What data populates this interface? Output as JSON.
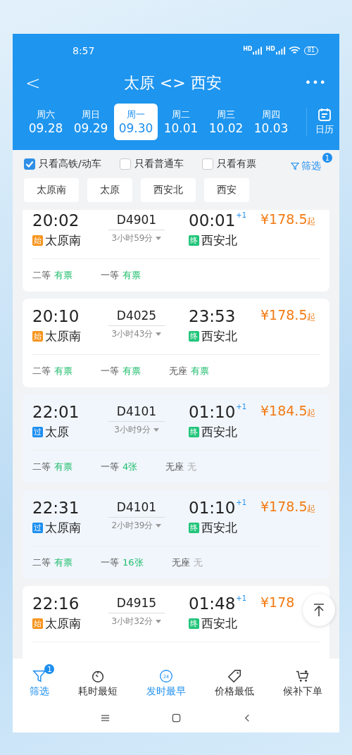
{
  "status_bar": {
    "time": "8:57",
    "signal_labels": [
      "HD",
      "HD"
    ],
    "battery": "81"
  },
  "header": {
    "back": "<",
    "title": "太原 <> 西安",
    "more": "•••"
  },
  "dates": [
    {
      "weekday": "周六",
      "date": "09.28",
      "selected": false
    },
    {
      "weekday": "周日",
      "date": "09.29",
      "selected": false
    },
    {
      "weekday": "周一",
      "date": "09.30",
      "selected": true
    },
    {
      "weekday": "周二",
      "date": "10.01",
      "selected": false
    },
    {
      "weekday": "周三",
      "date": "10.02",
      "selected": false
    },
    {
      "weekday": "周四",
      "date": "10.03",
      "selected": false
    }
  ],
  "calendar": {
    "label": "日历"
  },
  "filters": [
    {
      "label": "只看高铁/动车",
      "checked": true
    },
    {
      "label": "只看普通车",
      "checked": false
    },
    {
      "label": "只看有票",
      "checked": false
    }
  ],
  "filter_button": {
    "label": "筛选",
    "badge": "1"
  },
  "stations": [
    "太原南",
    "太原",
    "西安北",
    "西安"
  ],
  "trains": [
    {
      "depart": "20:02",
      "from": {
        "name": "太原南",
        "badge": "始",
        "kind": "start"
      },
      "number": "D4901",
      "duration": "3小时59分",
      "arrive": "00:01",
      "next_day": "+1",
      "to": {
        "name": "西安北",
        "badge": "终",
        "kind": "end"
      },
      "price": "¥178.5",
      "price_suffix": "起",
      "highlighted": false,
      "seats": [
        {
          "class": "二等",
          "status": "有票",
          "available": true
        },
        {
          "class": "一等",
          "status": "有票",
          "available": true
        }
      ]
    },
    {
      "depart": "20:10",
      "from": {
        "name": "太原南",
        "badge": "始",
        "kind": "start"
      },
      "number": "D4025",
      "duration": "3小时43分",
      "arrive": "23:53",
      "to": {
        "name": "西安北",
        "badge": "终",
        "kind": "end"
      },
      "price": "¥178.5",
      "price_suffix": "起",
      "highlighted": false,
      "seats": [
        {
          "class": "二等",
          "status": "有票",
          "available": true
        },
        {
          "class": "一等",
          "status": "有票",
          "available": true
        },
        {
          "class": "无座",
          "status": "有票",
          "available": true
        }
      ]
    },
    {
      "depart": "22:01",
      "from": {
        "name": "太原",
        "badge": "过",
        "kind": "pass"
      },
      "number": "D4101",
      "duration": "3小时9分",
      "arrive": "01:10",
      "next_day": "+1",
      "to": {
        "name": "西安北",
        "badge": "终",
        "kind": "end"
      },
      "price": "¥184.5",
      "price_suffix": "起",
      "highlighted": true,
      "seats": [
        {
          "class": "二等",
          "status": "有票",
          "available": true
        },
        {
          "class": "一等",
          "status": "4张",
          "available": true
        },
        {
          "class": "无座",
          "status": "无",
          "available": false
        }
      ]
    },
    {
      "depart": "22:31",
      "from": {
        "name": "太原南",
        "badge": "过",
        "kind": "pass"
      },
      "number": "D4101",
      "duration": "2小时39分",
      "arrive": "01:10",
      "next_day": "+1",
      "to": {
        "name": "西安北",
        "badge": "终",
        "kind": "end"
      },
      "price": "¥178.5",
      "price_suffix": "起",
      "highlighted": true,
      "seats": [
        {
          "class": "二等",
          "status": "有票",
          "available": true
        },
        {
          "class": "一等",
          "status": "16张",
          "available": true
        },
        {
          "class": "无座",
          "status": "无",
          "available": false
        }
      ]
    },
    {
      "depart": "22:16",
      "from": {
        "name": "太原南",
        "badge": "始",
        "kind": "start"
      },
      "number": "D4915",
      "duration": "3小时32分",
      "arrive": "01:48",
      "next_day": "+1",
      "to": {
        "name": "西安北",
        "badge": "终",
        "kind": "end"
      },
      "price": "¥178",
      "highlighted": false
    }
  ],
  "bottom_tabs": [
    {
      "label": "筛选",
      "kind": "filter",
      "badge": "1",
      "selected": true
    },
    {
      "label": "耗时最短",
      "kind": "timer",
      "selected": false
    },
    {
      "label": "发时最早",
      "kind": "clock",
      "icon_text": "24",
      "selected": true
    },
    {
      "label": "价格最低",
      "kind": "tag",
      "selected": false
    },
    {
      "label": "候补下单",
      "kind": "cart",
      "selected": false
    }
  ]
}
